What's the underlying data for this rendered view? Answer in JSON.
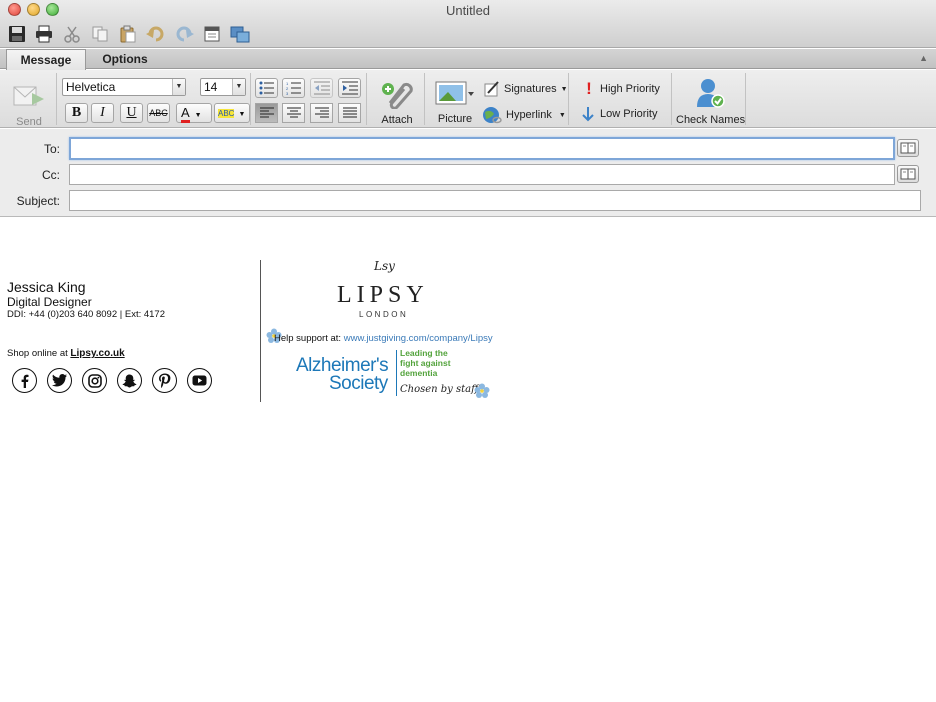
{
  "window": {
    "title": "Untitled"
  },
  "tabs": [
    {
      "label": "Message"
    },
    {
      "label": "Options"
    }
  ],
  "ribbon": {
    "send_label": "Send",
    "font_name": "Helvetica",
    "font_size": "14",
    "bold": "B",
    "italic": "I",
    "underline": "U",
    "strike": "ABC",
    "font_color_glyph": "A",
    "highlight_glyph": "ABC",
    "attach_label": "Attach",
    "picture_label": "Picture",
    "signatures_label": "Signatures",
    "hyperlink_label": "Hyperlink",
    "high_priority_label": "High Priority",
    "low_priority_label": "Low Priority",
    "check_names_label": "Check Names"
  },
  "fields": {
    "to_label": "To:",
    "cc_label": "Cc:",
    "subject_label": "Subject:",
    "to_value": "",
    "cc_value": "",
    "subject_value": ""
  },
  "signature": {
    "name": "Jessica King",
    "title": "Digital Designer",
    "ddi": "DDI: +44 (0)203 640 8092 | Ext: 4172",
    "shop_prefix": "Shop online at ",
    "shop_link": "Lipsy.co.uk",
    "brand_script": "Lsy",
    "brand_word": "LIPSY",
    "brand_city": "LONDON",
    "help_prefix": "Help support at: ",
    "help_url": "www.justgiving.com/company/Lipsy",
    "charity_line1": "Alzheimer's",
    "charity_line2": "Society",
    "charity_tag1": "Leading the",
    "charity_tag2": "fight against",
    "charity_tag3": "dementia",
    "charity_chosen": "Chosen by staff"
  },
  "colors": {
    "accent_blue": "#1d78b8",
    "charity_green": "#53a33c",
    "link_blue": "#3a7ab8",
    "focus_ring": "#7ea6d8"
  },
  "icons": {
    "social": [
      "facebook-icon",
      "twitter-icon",
      "instagram-icon",
      "snapchat-icon",
      "pinterest-icon",
      "youtube-icon"
    ]
  }
}
